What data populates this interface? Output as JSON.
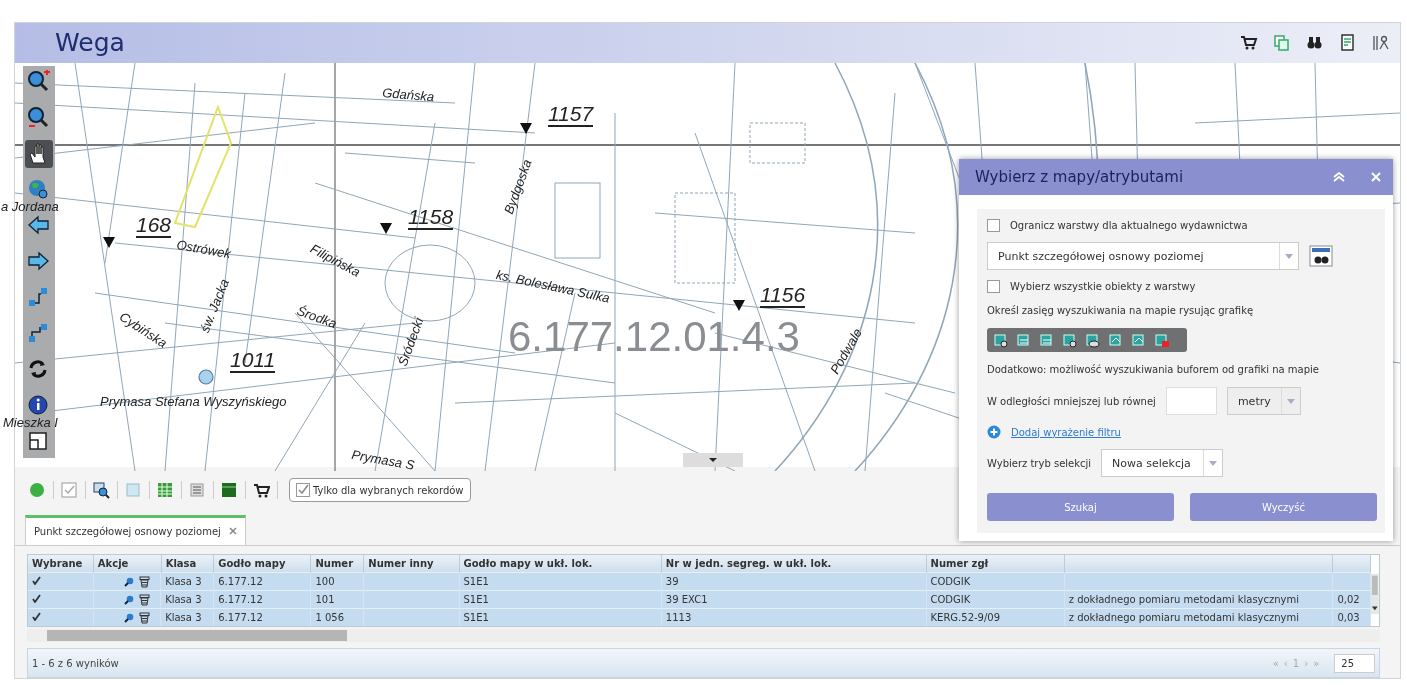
{
  "header": {
    "title": "Wega",
    "tools": [
      {
        "kind": "cart"
      },
      {
        "kind": "layers"
      },
      {
        "kind": "binoculars"
      },
      {
        "kind": "document"
      },
      {
        "kind": "person-list"
      }
    ]
  },
  "map": {
    "tools": [
      {
        "kind": "zoom-in",
        "selected": false
      },
      {
        "kind": "zoom-out",
        "selected": false
      },
      {
        "kind": "pan",
        "selected": true
      },
      {
        "kind": "zoom-extent",
        "selected": false
      },
      {
        "kind": "back",
        "selected": false
      },
      {
        "kind": "forward",
        "selected": false
      },
      {
        "kind": "step-up",
        "selected": false
      },
      {
        "kind": "step-down",
        "selected": false
      },
      {
        "kind": "refresh",
        "selected": false
      },
      {
        "kind": "info",
        "selected": false
      },
      {
        "kind": "legend",
        "selected": false
      }
    ],
    "labels": [
      {
        "kind": "street",
        "text": "Gdańska"
      },
      {
        "kind": "point",
        "text": "1157"
      },
      {
        "kind": "street",
        "text": "Bydgoska"
      },
      {
        "kind": "point",
        "text": "1158"
      },
      {
        "kind": "point",
        "text": "168"
      },
      {
        "kind": "street",
        "text": "a Jordana"
      },
      {
        "kind": "street",
        "text": "Ostrówek"
      },
      {
        "kind": "street",
        "text": "Filipińska"
      },
      {
        "kind": "street",
        "text": "ks. Bolesława Sulka"
      },
      {
        "kind": "point",
        "text": "1156"
      },
      {
        "kind": "sheet",
        "text": "6.177.12.01.4.3"
      },
      {
        "kind": "street",
        "text": "Cybińska"
      },
      {
        "kind": "street",
        "text": "św. Jacka"
      },
      {
        "kind": "street",
        "text": "Środka"
      },
      {
        "kind": "street",
        "text": "Śródecki"
      },
      {
        "kind": "street",
        "text": "Podwale"
      },
      {
        "kind": "point",
        "text": "1011"
      },
      {
        "kind": "street",
        "text": "Prymasa Stefana Wyszyńskiego"
      },
      {
        "kind": "street",
        "text": "Mieszka I"
      },
      {
        "kind": "street",
        "text": "Prymasa S"
      }
    ]
  },
  "bottom": {
    "tools": [
      {
        "kind": "green-dot"
      },
      {
        "kind": "checkbox"
      },
      {
        "kind": "zoom-to"
      },
      {
        "kind": "square"
      },
      {
        "kind": "table"
      },
      {
        "kind": "list"
      },
      {
        "kind": "table-dark"
      },
      {
        "kind": "cart"
      }
    ],
    "only_selected": {
      "label": "Tylko dla wybranych rekordów",
      "checked": true
    },
    "tabs": [
      {
        "label": "Punkt szczegółowej osnowy poziomej",
        "selected": true
      }
    ],
    "table": {
      "columns": [
        {
          "label": "Wybrane",
          "kind": "check"
        },
        {
          "label": "Akcje",
          "kind": "actions"
        },
        {
          "label": "Klasa",
          "kind": "text"
        },
        {
          "label": "Godło mapy",
          "kind": "text"
        },
        {
          "label": "Numer",
          "kind": "text"
        },
        {
          "label": "Numer inny",
          "kind": "text"
        },
        {
          "label": "Godło mapy w ukł. lok.",
          "kind": "text"
        },
        {
          "label": "Nr w jedn. segreg. w ukł. lok.",
          "kind": "text"
        },
        {
          "label": "Numer zgł",
          "kind": "text"
        },
        {
          "kind": "text"
        },
        {
          "kind": "text"
        }
      ],
      "rows": [
        {
          "selected": true,
          "cells": [
            "",
            "",
            "Klasa 3",
            "6.177.12",
            "100",
            "",
            "S1E1",
            "39",
            "CODGIK"
          ]
        },
        {
          "selected": true,
          "cells": [
            "",
            "",
            "Klasa 3",
            "6.177.12",
            "101",
            "",
            "S1E1",
            "39 EXC1",
            "CODGIK",
            "z dokładnego pomiaru metodami klasycznymi",
            "0,02"
          ]
        },
        {
          "selected": true,
          "cells": [
            "",
            "",
            "Klasa 3",
            "6.177.12",
            "1 056",
            "",
            "S1E1",
            "1113",
            "KERG.52-9/09",
            "z dokładnego pomiaru metodami klasycznymi",
            "0,03"
          ]
        }
      ]
    },
    "footer": {
      "summary": "1 - 6 z 6 wyników",
      "pager": [
        "«",
        "‹",
        "1",
        "›",
        "»"
      ],
      "page_size": "25"
    }
  },
  "dialog": {
    "title": "Wybierz z mapy/atrybutami",
    "restrict": {
      "label": "Ogranicz warstwy dla aktualnego wydawnictwa",
      "checked": false
    },
    "layer": "Punkt szczegółowej osnowy poziomej",
    "select_all": {
      "label": "Wybierz wszystkie obiekty z warstwy",
      "checked": false
    },
    "range_text": "Określ zasięg wyszukiwania na mapie rysując grafikę",
    "draw_tools": [
      {
        "kind": "point"
      },
      {
        "kind": "line"
      },
      {
        "kind": "polyline"
      },
      {
        "kind": "circle"
      },
      {
        "kind": "ellipse"
      },
      {
        "kind": "polygon"
      },
      {
        "kind": "freehand"
      },
      {
        "kind": "clear"
      }
    ],
    "buffer_text": "Dodatkowo: możliwość wyszukiwania buforem od grafiki na mapie",
    "distance_label": "W odległości mniejszej lub równej",
    "unit": "metry",
    "add_filter": "Dodaj wyrażenie filtru",
    "mode_label": "Wybierz tryb selekcji",
    "mode": "Nowa selekcja",
    "buttons": [
      "Szukaj",
      "Wyczyść"
    ]
  }
}
